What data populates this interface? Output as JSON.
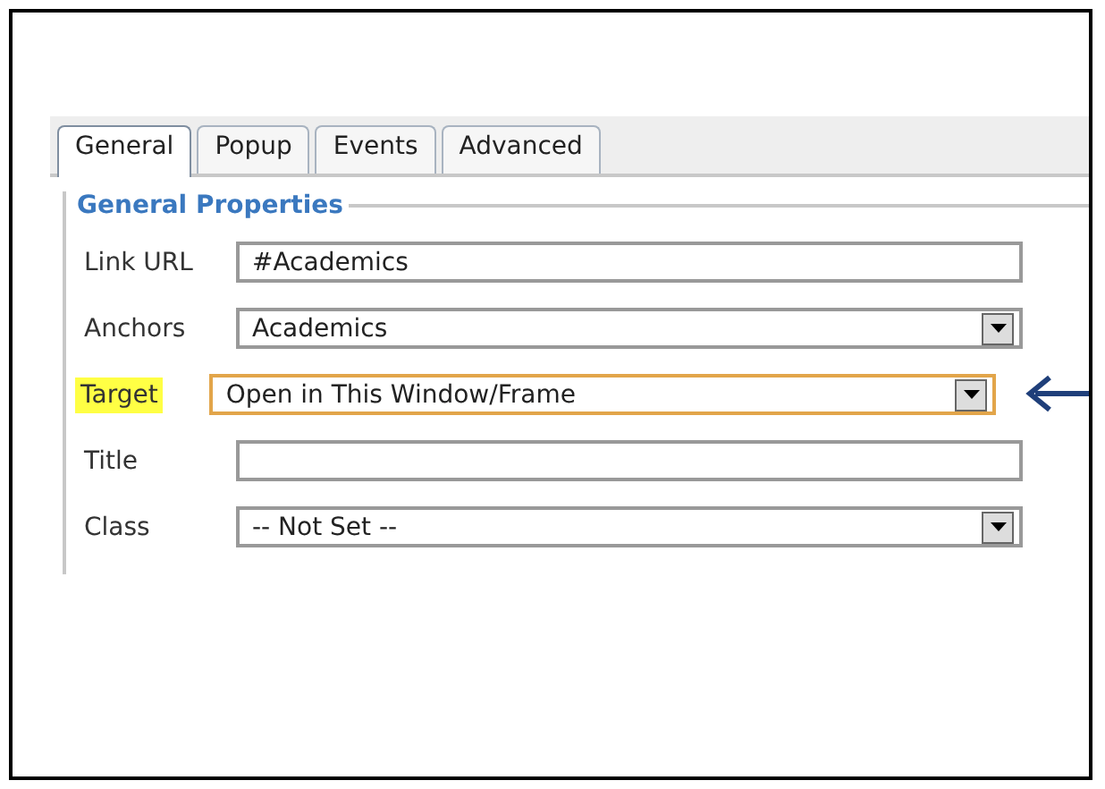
{
  "tabs": [
    {
      "label": "General",
      "selected": true
    },
    {
      "label": "Popup",
      "selected": false
    },
    {
      "label": "Events",
      "selected": false
    },
    {
      "label": "Advanced",
      "selected": false
    }
  ],
  "group": {
    "title": "General Properties"
  },
  "fields": [
    {
      "label": "Link URL",
      "kind": "text",
      "value": "#Academics",
      "highlighted": false,
      "focused": false
    },
    {
      "label": "Anchors",
      "kind": "select",
      "value": "Academics",
      "highlighted": false,
      "focused": false
    },
    {
      "label": "Target",
      "kind": "select",
      "value": "Open in This Window/Frame",
      "highlighted": true,
      "focused": true
    },
    {
      "label": "Title",
      "kind": "text",
      "highlighted": false,
      "focused": false
    },
    {
      "label": "Class",
      "kind": "select",
      "value": "-- Not Set --",
      "highlighted": false,
      "focused": false
    }
  ]
}
